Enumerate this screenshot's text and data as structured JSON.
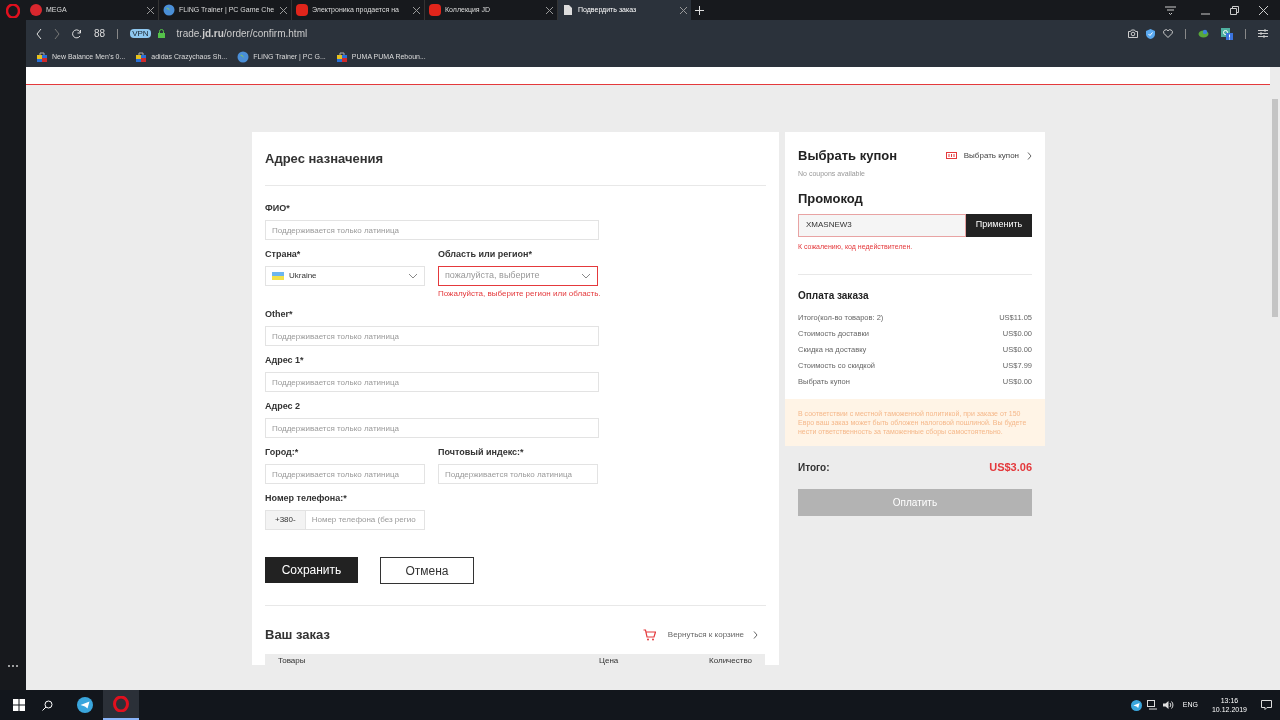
{
  "browser": {
    "tabs": [
      {
        "title": "MEGA",
        "selected": false
      },
      {
        "title": "FLiNG Trainer | PC Game Che",
        "selected": false
      },
      {
        "title": "Электроника продается на",
        "selected": false
      },
      {
        "title": "Коллекция JD",
        "selected": false
      },
      {
        "title": "Подвердить заказ",
        "selected": true
      }
    ],
    "address": "trade.**jd.ru**/order/confirm.html",
    "vpn": "VPN",
    "speed_dial": "88",
    "bookmarks": [
      {
        "title": "New Balance Men's 0..."
      },
      {
        "title": "adidas Crazychaos Sh..."
      },
      {
        "title": "FLiNG Trainer | PC G..."
      },
      {
        "title": "PUMA PUMA Reboun..."
      }
    ]
  },
  "address_form": {
    "title": "Адрес назначения",
    "rows": [
      [
        {
          "kind": "text",
          "label": "ФИО*",
          "placeholder": "Поддерживается только латиница"
        }
      ],
      [
        {
          "kind": "select",
          "label": "Страна*",
          "value": "Ukraine"
        },
        {
          "kind": "select",
          "label": "Область или регион*",
          "placeholder": "пожалуйста, выберите",
          "error": "Пожалуйста, выберите регион или область."
        }
      ],
      [
        {
          "kind": "text",
          "label": "Other*",
          "placeholder": "Поддерживается только латиница"
        }
      ],
      [
        {
          "kind": "text",
          "label": "Адрес 1*",
          "placeholder": "Поддерживается только латиница"
        }
      ],
      [
        {
          "kind": "text",
          "label": "Адрес 2",
          "placeholder": "Поддерживается только латиница"
        }
      ],
      [
        {
          "kind": "text",
          "label": "Город:*",
          "placeholder": "Поддерживается только латиница"
        },
        {
          "kind": "text",
          "label": "Почтовый индекс:*",
          "placeholder": "Поддерживается только латиница"
        }
      ],
      [
        {
          "kind": "phone",
          "label": "Номер телефона:*",
          "prefix": "+380-",
          "placeholder": "Номер телефона (без регио"
        }
      ]
    ],
    "save": "Сохранить",
    "cancel": "Отмена"
  },
  "order": {
    "title": "Ваш заказ",
    "back_link": "Вернуться к корзине",
    "columns": [
      "Товары",
      "Цена",
      "Количество"
    ]
  },
  "coupon": {
    "title": "Выбрать купон",
    "link": "Выбрать купон",
    "note": "No coupons available"
  },
  "promo": {
    "title": "Промокод",
    "value": "XMASNEW3",
    "apply": "Применить",
    "error": "К сожалению, код недействителен."
  },
  "payment": {
    "title": "Оплата заказа",
    "rows": [
      {
        "label": "Итого(кол-во товаров: 2)",
        "value": "US$11.05"
      },
      {
        "label": "Стоимость доставки",
        "value": "US$0.00"
      },
      {
        "label": "Скидка на доставку",
        "value": "US$0.00"
      },
      {
        "label": "Стоимость со скидкой",
        "value": "US$7.99"
      },
      {
        "label": "Выбрать купон",
        "value": "US$0.00"
      }
    ],
    "notice": "В соответствии с местной таможенной политикой, при заказе от 150 Евро ваш заказ может быть обложен налоговой пошлиной. Вы будете нести ответственность за таможенные сборы самостоятельно.",
    "total_label": "Итого:",
    "total": "US$3.06",
    "pay": "Оплатить",
    "pay_disabled": true
  },
  "taskbar": {
    "language": "ENG",
    "time": "13:16",
    "date": "10.12.2019"
  }
}
